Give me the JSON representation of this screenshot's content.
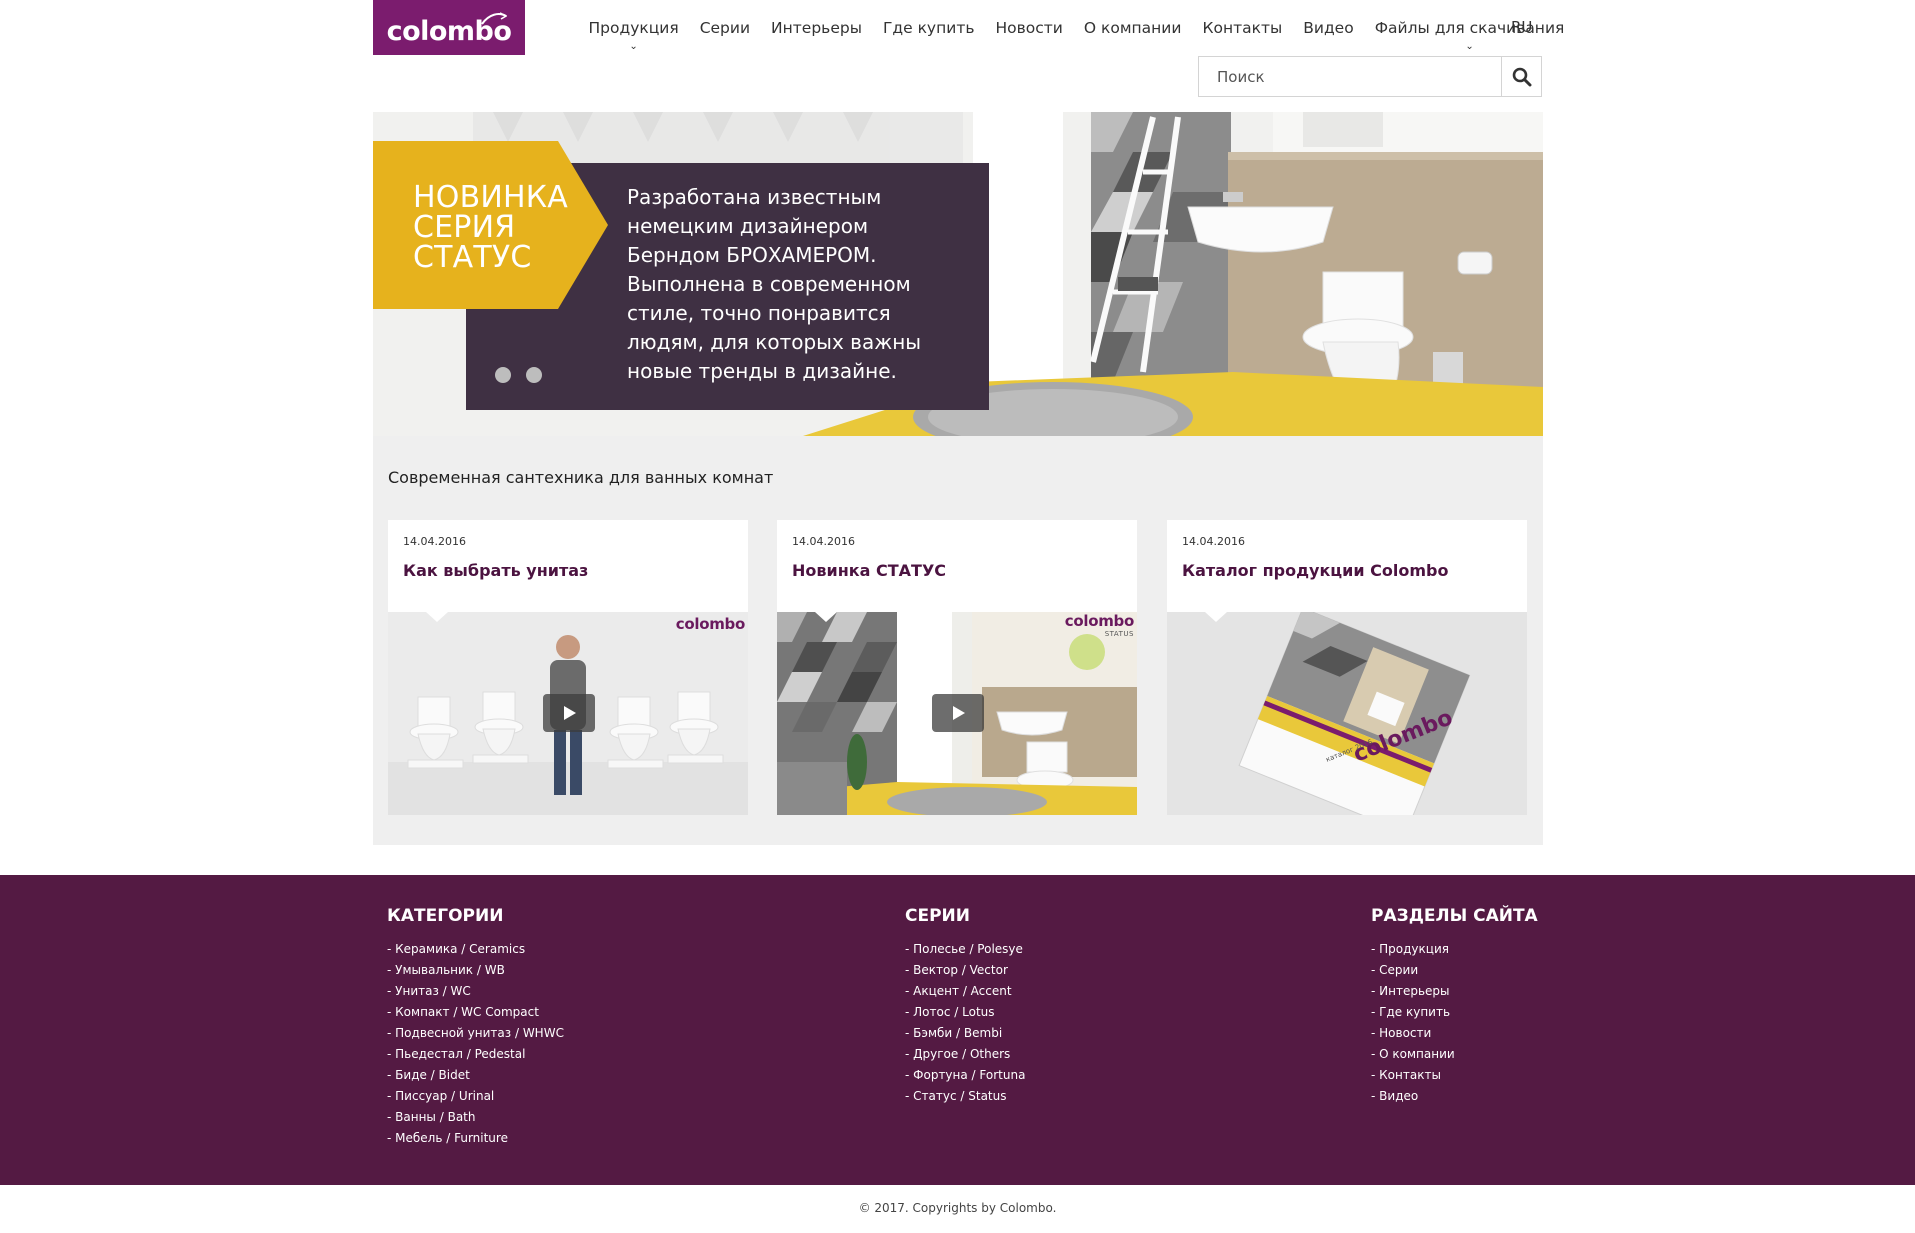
{
  "header": {
    "logo_text": "colombo",
    "nav": [
      {
        "label": "Продукция",
        "dropdown": true
      },
      {
        "label": "Серии",
        "dropdown": false
      },
      {
        "label": "Интерьеры",
        "dropdown": false
      },
      {
        "label": "Где купить",
        "dropdown": false
      },
      {
        "label": "Новости",
        "dropdown": false
      },
      {
        "label": "О компании",
        "dropdown": false
      },
      {
        "label": "Контакты",
        "dropdown": false
      },
      {
        "label": "Видео",
        "dropdown": false
      },
      {
        "label": "Файлы для скачивания",
        "dropdown": true
      }
    ],
    "lang": "RU",
    "search_placeholder": "Поиск",
    "icons": {
      "search": "search-icon",
      "dropdown": "chevron-down-icon"
    }
  },
  "hero": {
    "tag_lines": [
      "НОВИНКА",
      "СЕРИЯ",
      "СТАТУС"
    ],
    "description_lines": [
      "Разработана известным",
      "немецким дизайнером",
      "Берндом БРОХАМЕРОМ.",
      "Выполнена в современном",
      "стиле, точно понравится",
      "людям, для которых важны",
      "новые тренды в дизайне."
    ],
    "slides": 2,
    "colors": {
      "tag": "#e6b21d",
      "box": "#3f3043",
      "floor": "#e9c83a"
    }
  },
  "news": {
    "section_title": "Современная сантехника для ванных комнат",
    "cards": [
      {
        "date": "14.04.2016",
        "title": "Как выбрать унитаз",
        "video": true,
        "image": "person-with-toilets",
        "img_logo": "colombo"
      },
      {
        "date": "14.04.2016",
        "title": "Новинка СТАТУС",
        "video": true,
        "image": "bathroom-interior",
        "img_logo": "colombo",
        "img_logo_sub": "STATUS"
      },
      {
        "date": "14.04.2016",
        "title": "Каталог продукции Colombo",
        "video": false,
        "image": "catalog-brochure",
        "img_logo": "",
        "catalog_label": "каталог 2016",
        "catalog_brand": "colombo"
      }
    ]
  },
  "footer": {
    "categories": {
      "title": "КАТЕГОРИИ",
      "items": [
        "Керамика / Ceramics",
        "Умывальник / WB",
        "Унитаз / WC",
        "Компакт / WC Compact",
        "Подвесной унитаз / WHWC",
        "Пьедестал / Pedestal",
        "Биде / Bidet",
        "Писсуар / Urinal",
        "Ванны / Bath",
        "Мебель / Furniture"
      ]
    },
    "series": {
      "title": "СЕРИИ",
      "items": [
        "Полесье / Polesye",
        "Вектор / Vector",
        "Акцент / Accent",
        "Лотос / Lotus",
        "Бэмби / Bembi",
        "Другое / Others",
        "Фортуна / Fortuna",
        "Статус / Status"
      ]
    },
    "sections": {
      "title": "РАЗДЕЛЫ САЙТА",
      "items": [
        "Продукция",
        "Серии",
        "Интерьеры",
        "Где купить",
        "Новости",
        "О компании",
        "Контакты",
        "Видео"
      ]
    },
    "copyright": "© 2017. Copyrights by Colombo."
  },
  "colors": {
    "brand": "#7b1c6e",
    "footer": "#541a43",
    "accent_yellow": "#e6b21d"
  }
}
